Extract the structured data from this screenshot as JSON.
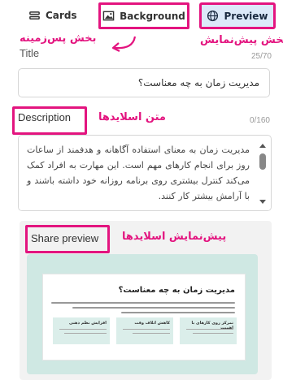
{
  "tabs": [
    {
      "label": "Cards",
      "icon": "cards-icon"
    },
    {
      "label": "Background",
      "icon": "image-icon"
    },
    {
      "label": "Preview",
      "icon": "globe-icon",
      "active": true
    }
  ],
  "annotations": {
    "background_section": "بخش پس‌زمینه",
    "preview_section": "بخش پیش‌نمایش",
    "slides_text": "متن اسلایدها",
    "slides_preview": "پیش‌نمایش اسلایدها"
  },
  "title_field": {
    "label": "Title",
    "counter": "25/70",
    "value": "مدیریت زمان به چه معناست؟"
  },
  "description_field": {
    "label": "Description",
    "counter": "0/160",
    "value": "مدیریت زمان به معنای استفاده آگاهانه و هدفمند از ساعات روز برای انجام کارهای مهم است. این مهارت به افراد کمک می‌کند کنترل بیشتری روی برنامه روزانه خود داشته باشند و با آرامش بیشتر کار کنند."
  },
  "share_preview": {
    "label": "Share preview",
    "card_title": "مدیریت زمان به چه معناست؟",
    "columns": [
      {
        "title": "تمرکز روی کارهای با اهمیت"
      },
      {
        "title": "کاهش اتلاف وقت"
      },
      {
        "title": "افزایش نظم ذهنی"
      }
    ]
  },
  "colors": {
    "accent": "#e3147f",
    "active_tab_bg": "#dce9f9",
    "preview_bg": "#cfe8e3"
  }
}
